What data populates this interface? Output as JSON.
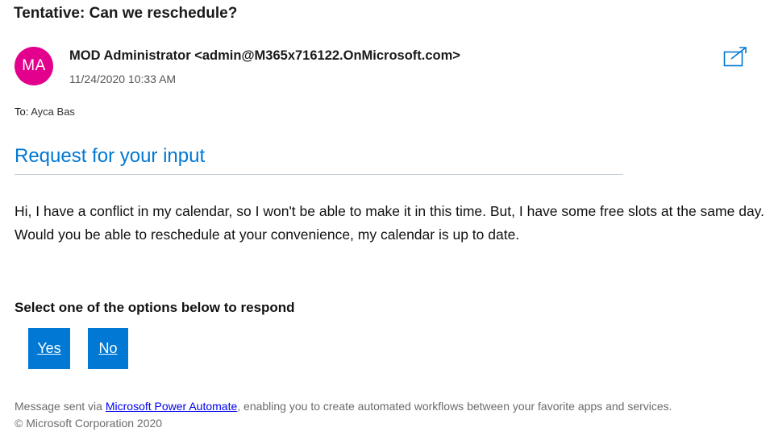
{
  "email": {
    "subject": "Tentative: Can we reschedule?",
    "avatar_initials": "MA",
    "avatar_color": "#e3008c",
    "sender": "MOD Administrator <admin@M365x716122.OnMicrosoft.com>",
    "timestamp": "11/24/2020 10:33 AM",
    "to_label": "To:",
    "to_value": "Ayca Bas",
    "popout_icon": "popout-icon"
  },
  "card": {
    "title": "Request for your input",
    "message": "Hi, I have a conflict in my calendar, so I won't be able to make it in this time. But, I have some free slots at the same day. Would you be able to reschedule at your convenience, my calendar is up to date.",
    "prompt": "Select one of the options below to respond",
    "yes_label": "Yes",
    "no_label": "No",
    "accent_color": "#0078d4"
  },
  "footer": {
    "prefix": "Message sent via ",
    "link_text": "Microsoft Power Automate",
    "suffix": ", enabling you to create automated workflows between your favorite apps and services.",
    "copyright": "© Microsoft Corporation 2020"
  }
}
